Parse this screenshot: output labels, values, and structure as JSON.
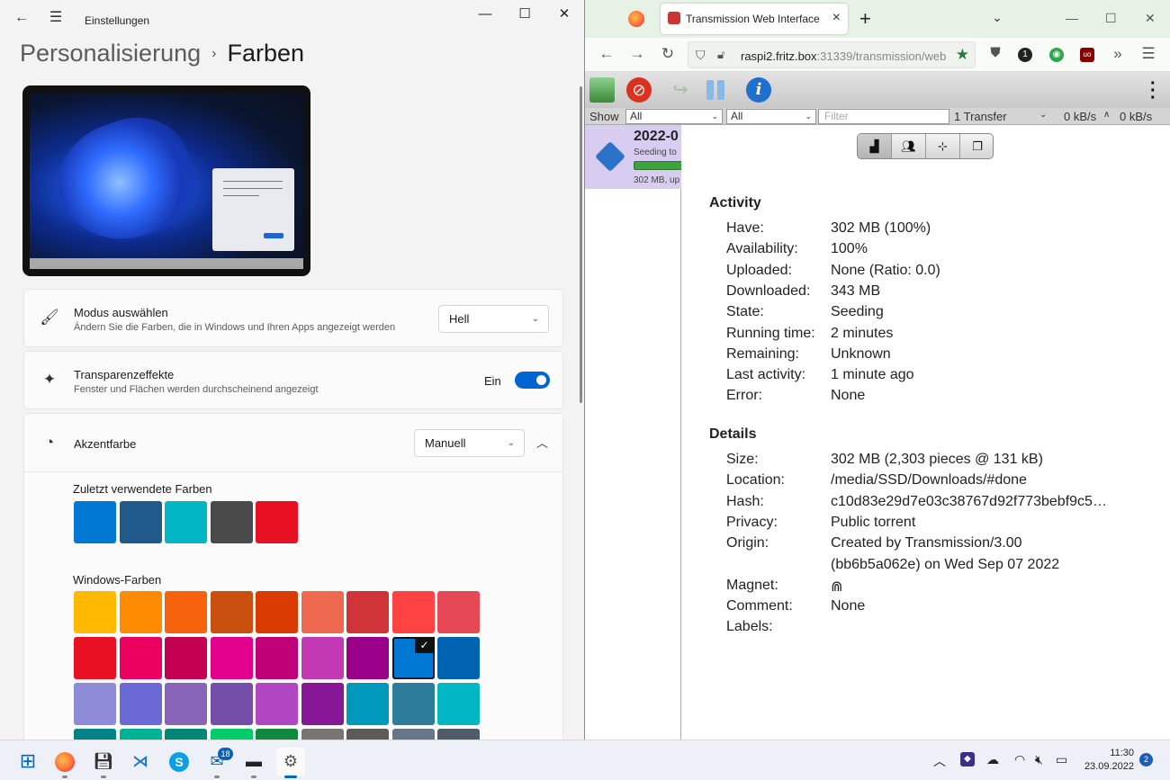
{
  "settings": {
    "app_title": "Einstellungen",
    "breadcrumb_parent": "Personalisierung",
    "breadcrumb_current": "Farben",
    "mode": {
      "title": "Modus auswählen",
      "subtitle": "Ändern Sie die Farben, die in Windows und Ihren Apps angezeigt werden",
      "value": "Hell",
      "icon": "paintbrush-icon"
    },
    "transparency": {
      "title": "Transparenzeffekte",
      "subtitle": "Fenster und Flächen werden durchscheinend angezeigt",
      "state_label": "Ein",
      "enabled": true,
      "icon": "sparkle-icon"
    },
    "accent": {
      "title": "Akzentfarbe",
      "value": "Manuell",
      "icon": "palette-icon"
    },
    "recent_label": "Zuletzt verwendete Farben",
    "recent_colors": [
      "#0078d4",
      "#1f5a8a",
      "#00b7c3",
      "#4a4a4a",
      "#e81123"
    ],
    "windows_label": "Windows-Farben",
    "windows_colors": [
      [
        "#ffb900",
        "#ff8c00",
        "#f7630c",
        "#ca5010",
        "#da3b01",
        "#ef6950",
        "#d13438",
        "#ff4343",
        "#e74856"
      ],
      [
        "#e81123",
        "#ea005e",
        "#c30052",
        "#e3008c",
        "#bf0077",
        "#c239b3",
        "#9a0089",
        "#0078d4",
        "#0063b1"
      ],
      [
        "#8e8cd8",
        "#6b69d6",
        "#8764b8",
        "#744da9",
        "#b146c2",
        "#881798",
        "#0099bc",
        "#2d7d9a",
        "#00b7c3"
      ],
      [
        "#038387",
        "#00b294",
        "#018574",
        "#00cc6a",
        "#10893e",
        "#7a7574",
        "#5d5a58",
        "#68768a",
        "#515c6b"
      ]
    ],
    "selected_color": "#0078d4"
  },
  "browser": {
    "tab_title": "Transmission Web Interface",
    "url_host": "raspi2.fritz.box",
    "url_rest": ":31339/transmission/web",
    "ext_badge_1": "1",
    "ext_badge_2": "uo"
  },
  "transmission": {
    "filter_show": "Show",
    "filter_all_1": "All",
    "filter_all_2": "All",
    "filter_placeholder": "Filter",
    "transfer_count": "1 Transfer",
    "down_speed": "0 kB/s",
    "up_speed": "0 kB/s",
    "torrent": {
      "name": "2022-0",
      "status": "Seeding to",
      "meta": "302 MB, up",
      "progress": 1.0
    },
    "activity_heading": "Activity",
    "activity": [
      {
        "k": "Have:",
        "v": "302 MB (100%)"
      },
      {
        "k": "Availability:",
        "v": "100%"
      },
      {
        "k": "Uploaded:",
        "v": "None (Ratio: 0.0)"
      },
      {
        "k": "Downloaded:",
        "v": "343 MB"
      },
      {
        "k": "State:",
        "v": "Seeding"
      },
      {
        "k": "Running time:",
        "v": "2 minutes"
      },
      {
        "k": "Remaining:",
        "v": "Unknown"
      },
      {
        "k": "Last activity:",
        "v": "1 minute ago"
      },
      {
        "k": "Error:",
        "v": "None"
      }
    ],
    "details_heading": "Details",
    "details": [
      {
        "k": "Size:",
        "v": "302 MB (2,303 pieces @ 131 kB)"
      },
      {
        "k": "Location:",
        "v": "/media/SSD/Downloads/#done"
      },
      {
        "k": "Hash:",
        "v": "c10d83e29d7e03c38767d92f773bebf9c5…"
      },
      {
        "k": "Privacy:",
        "v": "Public torrent"
      },
      {
        "k": "Origin:",
        "v": "Created by Transmission/3.00"
      },
      {
        "k": "",
        "v": "(bb6b5a062e) on Wed Sep 07 2022"
      },
      {
        "k": "Magnet:",
        "v": "⋒"
      },
      {
        "k": "Comment:",
        "v": "None"
      },
      {
        "k": "Labels:",
        "v": ""
      }
    ]
  },
  "taskbar": {
    "mail_badge": "18",
    "time": "11:30",
    "date": "23.09.2022",
    "notifications": "2"
  }
}
